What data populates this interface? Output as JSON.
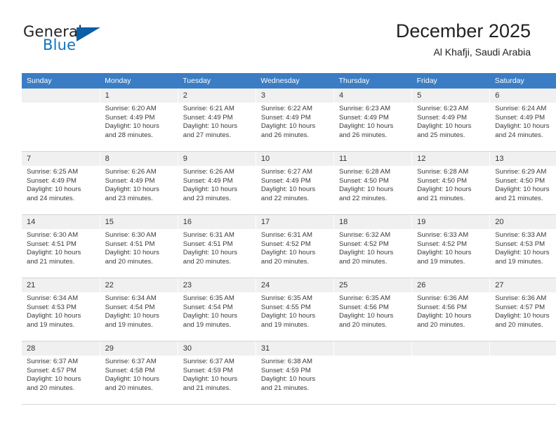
{
  "brand": {
    "word_one": "General",
    "word_two": "Blue",
    "triangle_icon": "brand-triangle-icon",
    "accent_color": "#1273bd",
    "dark_color": "#0b5ea8"
  },
  "header": {
    "title": "December 2025",
    "subtitle": "Al Khafji, Saudi Arabia"
  },
  "calendar": {
    "header_bg": "#3b7dc4",
    "daynum_bg": "#f0f0f0",
    "weekday_headers": [
      "Sunday",
      "Monday",
      "Tuesday",
      "Wednesday",
      "Thursday",
      "Friday",
      "Saturday"
    ],
    "labels": {
      "sunrise": "Sunrise:",
      "sunset": "Sunset:",
      "daylight": "Daylight:"
    },
    "weeks": [
      [
        {
          "day": "",
          "empty": true
        },
        {
          "day": "1",
          "sunrise": "Sunrise: 6:20 AM",
          "sunset": "Sunset: 4:49 PM",
          "daylight_1": "Daylight: 10 hours",
          "daylight_2": "and 28 minutes."
        },
        {
          "day": "2",
          "sunrise": "Sunrise: 6:21 AM",
          "sunset": "Sunset: 4:49 PM",
          "daylight_1": "Daylight: 10 hours",
          "daylight_2": "and 27 minutes."
        },
        {
          "day": "3",
          "sunrise": "Sunrise: 6:22 AM",
          "sunset": "Sunset: 4:49 PM",
          "daylight_1": "Daylight: 10 hours",
          "daylight_2": "and 26 minutes."
        },
        {
          "day": "4",
          "sunrise": "Sunrise: 6:23 AM",
          "sunset": "Sunset: 4:49 PM",
          "daylight_1": "Daylight: 10 hours",
          "daylight_2": "and 26 minutes."
        },
        {
          "day": "5",
          "sunrise": "Sunrise: 6:23 AM",
          "sunset": "Sunset: 4:49 PM",
          "daylight_1": "Daylight: 10 hours",
          "daylight_2": "and 25 minutes."
        },
        {
          "day": "6",
          "sunrise": "Sunrise: 6:24 AM",
          "sunset": "Sunset: 4:49 PM",
          "daylight_1": "Daylight: 10 hours",
          "daylight_2": "and 24 minutes."
        }
      ],
      [
        {
          "day": "7",
          "sunrise": "Sunrise: 6:25 AM",
          "sunset": "Sunset: 4:49 PM",
          "daylight_1": "Daylight: 10 hours",
          "daylight_2": "and 24 minutes."
        },
        {
          "day": "8",
          "sunrise": "Sunrise: 6:26 AM",
          "sunset": "Sunset: 4:49 PM",
          "daylight_1": "Daylight: 10 hours",
          "daylight_2": "and 23 minutes."
        },
        {
          "day": "9",
          "sunrise": "Sunrise: 6:26 AM",
          "sunset": "Sunset: 4:49 PM",
          "daylight_1": "Daylight: 10 hours",
          "daylight_2": "and 23 minutes."
        },
        {
          "day": "10",
          "sunrise": "Sunrise: 6:27 AM",
          "sunset": "Sunset: 4:49 PM",
          "daylight_1": "Daylight: 10 hours",
          "daylight_2": "and 22 minutes."
        },
        {
          "day": "11",
          "sunrise": "Sunrise: 6:28 AM",
          "sunset": "Sunset: 4:50 PM",
          "daylight_1": "Daylight: 10 hours",
          "daylight_2": "and 22 minutes."
        },
        {
          "day": "12",
          "sunrise": "Sunrise: 6:28 AM",
          "sunset": "Sunset: 4:50 PM",
          "daylight_1": "Daylight: 10 hours",
          "daylight_2": "and 21 minutes."
        },
        {
          "day": "13",
          "sunrise": "Sunrise: 6:29 AM",
          "sunset": "Sunset: 4:50 PM",
          "daylight_1": "Daylight: 10 hours",
          "daylight_2": "and 21 minutes."
        }
      ],
      [
        {
          "day": "14",
          "sunrise": "Sunrise: 6:30 AM",
          "sunset": "Sunset: 4:51 PM",
          "daylight_1": "Daylight: 10 hours",
          "daylight_2": "and 21 minutes."
        },
        {
          "day": "15",
          "sunrise": "Sunrise: 6:30 AM",
          "sunset": "Sunset: 4:51 PM",
          "daylight_1": "Daylight: 10 hours",
          "daylight_2": "and 20 minutes."
        },
        {
          "day": "16",
          "sunrise": "Sunrise: 6:31 AM",
          "sunset": "Sunset: 4:51 PM",
          "daylight_1": "Daylight: 10 hours",
          "daylight_2": "and 20 minutes."
        },
        {
          "day": "17",
          "sunrise": "Sunrise: 6:31 AM",
          "sunset": "Sunset: 4:52 PM",
          "daylight_1": "Daylight: 10 hours",
          "daylight_2": "and 20 minutes."
        },
        {
          "day": "18",
          "sunrise": "Sunrise: 6:32 AM",
          "sunset": "Sunset: 4:52 PM",
          "daylight_1": "Daylight: 10 hours",
          "daylight_2": "and 20 minutes."
        },
        {
          "day": "19",
          "sunrise": "Sunrise: 6:33 AM",
          "sunset": "Sunset: 4:52 PM",
          "daylight_1": "Daylight: 10 hours",
          "daylight_2": "and 19 minutes."
        },
        {
          "day": "20",
          "sunrise": "Sunrise: 6:33 AM",
          "sunset": "Sunset: 4:53 PM",
          "daylight_1": "Daylight: 10 hours",
          "daylight_2": "and 19 minutes."
        }
      ],
      [
        {
          "day": "21",
          "sunrise": "Sunrise: 6:34 AM",
          "sunset": "Sunset: 4:53 PM",
          "daylight_1": "Daylight: 10 hours",
          "daylight_2": "and 19 minutes."
        },
        {
          "day": "22",
          "sunrise": "Sunrise: 6:34 AM",
          "sunset": "Sunset: 4:54 PM",
          "daylight_1": "Daylight: 10 hours",
          "daylight_2": "and 19 minutes."
        },
        {
          "day": "23",
          "sunrise": "Sunrise: 6:35 AM",
          "sunset": "Sunset: 4:54 PM",
          "daylight_1": "Daylight: 10 hours",
          "daylight_2": "and 19 minutes."
        },
        {
          "day": "24",
          "sunrise": "Sunrise: 6:35 AM",
          "sunset": "Sunset: 4:55 PM",
          "daylight_1": "Daylight: 10 hours",
          "daylight_2": "and 19 minutes."
        },
        {
          "day": "25",
          "sunrise": "Sunrise: 6:35 AM",
          "sunset": "Sunset: 4:56 PM",
          "daylight_1": "Daylight: 10 hours",
          "daylight_2": "and 20 minutes."
        },
        {
          "day": "26",
          "sunrise": "Sunrise: 6:36 AM",
          "sunset": "Sunset: 4:56 PM",
          "daylight_1": "Daylight: 10 hours",
          "daylight_2": "and 20 minutes."
        },
        {
          "day": "27",
          "sunrise": "Sunrise: 6:36 AM",
          "sunset": "Sunset: 4:57 PM",
          "daylight_1": "Daylight: 10 hours",
          "daylight_2": "and 20 minutes."
        }
      ],
      [
        {
          "day": "28",
          "sunrise": "Sunrise: 6:37 AM",
          "sunset": "Sunset: 4:57 PM",
          "daylight_1": "Daylight: 10 hours",
          "daylight_2": "and 20 minutes."
        },
        {
          "day": "29",
          "sunrise": "Sunrise: 6:37 AM",
          "sunset": "Sunset: 4:58 PM",
          "daylight_1": "Daylight: 10 hours",
          "daylight_2": "and 20 minutes."
        },
        {
          "day": "30",
          "sunrise": "Sunrise: 6:37 AM",
          "sunset": "Sunset: 4:59 PM",
          "daylight_1": "Daylight: 10 hours",
          "daylight_2": "and 21 minutes."
        },
        {
          "day": "31",
          "sunrise": "Sunrise: 6:38 AM",
          "sunset": "Sunset: 4:59 PM",
          "daylight_1": "Daylight: 10 hours",
          "daylight_2": "and 21 minutes."
        },
        {
          "day": "",
          "empty": true
        },
        {
          "day": "",
          "empty": true
        },
        {
          "day": "",
          "empty": true
        }
      ]
    ]
  }
}
